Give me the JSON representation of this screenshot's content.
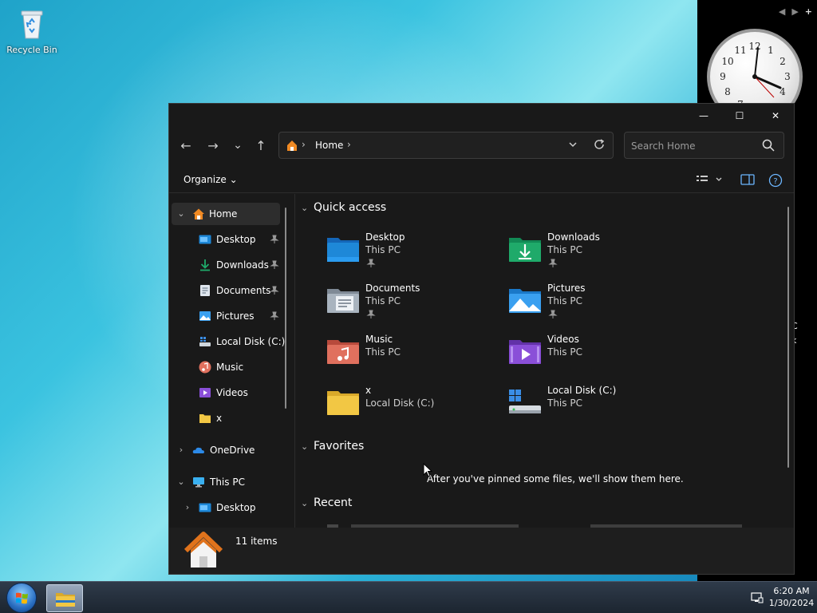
{
  "desktop": {
    "recycle_bin_label": "Recycle Bin",
    "side_text": [
      "C",
      "k"
    ]
  },
  "explorer": {
    "window_controls": {
      "minimize": "—",
      "maximize": "☐",
      "close": "✕"
    },
    "nav": {
      "back": "←",
      "forward": "→",
      "recent": "⌄",
      "up": "↑"
    },
    "address": {
      "crumb": "Home",
      "separator": "›"
    },
    "search": {
      "placeholder": "Search Home"
    },
    "command_bar": {
      "organize_label": "Organize",
      "organize_chevron": "⌄"
    },
    "nav_pane": {
      "items": [
        {
          "label": "Home",
          "chevron": "⌄",
          "icon": "home-icon",
          "active": true
        },
        {
          "label": "Desktop",
          "icon": "desktop-folder-icon",
          "pinned": true
        },
        {
          "label": "Downloads",
          "icon": "download-icon",
          "pinned": true
        },
        {
          "label": "Documents",
          "icon": "documents-icon",
          "pinned": true
        },
        {
          "label": "Pictures",
          "icon": "pictures-icon",
          "pinned": true
        },
        {
          "label": "Local Disk (C:)",
          "icon": "drive-icon"
        },
        {
          "label": "Music",
          "icon": "music-icon"
        },
        {
          "label": "Videos",
          "icon": "videos-icon"
        },
        {
          "label": "x",
          "icon": "folder-icon"
        },
        {
          "label": "OneDrive",
          "chevron": "›",
          "icon": "onedrive-icon"
        },
        {
          "label": "This PC",
          "chevron": "⌄",
          "icon": "this-pc-icon"
        },
        {
          "label": "Desktop",
          "chevron": "›",
          "icon": "desktop-folder-icon"
        }
      ]
    },
    "content": {
      "quick_access": {
        "title": "Quick access",
        "chevron": "⌄",
        "items": [
          {
            "name": "Desktop",
            "location": "This PC",
            "pinned": true,
            "icon": "desktop-folder-icon"
          },
          {
            "name": "Downloads",
            "location": "This PC",
            "pinned": true,
            "icon": "download-icon"
          },
          {
            "name": "Documents",
            "location": "This PC",
            "pinned": true,
            "icon": "documents-icon"
          },
          {
            "name": "Pictures",
            "location": "This PC",
            "pinned": true,
            "icon": "pictures-icon"
          },
          {
            "name": "Music",
            "location": "This PC",
            "icon": "music-icon"
          },
          {
            "name": "Videos",
            "location": "This PC",
            "icon": "videos-icon"
          },
          {
            "name": "x",
            "location": "Local Disk (C:)",
            "icon": "folder-icon"
          },
          {
            "name": "Local Disk (C:)",
            "location": "This PC",
            "icon": "drive-icon"
          }
        ]
      },
      "favorites": {
        "title": "Favorites",
        "chevron": "⌄",
        "empty_message": "After you've pinned some files, we'll show them here."
      },
      "recent": {
        "title": "Recent",
        "chevron": "⌄"
      }
    },
    "status_bar": {
      "item_count": "11 items"
    }
  },
  "taskbar": {
    "time": "6:20 AM",
    "date": "1/30/2024"
  },
  "colors": {
    "window_bg": "#191919",
    "folder_blue": "#1e88d8",
    "folder_yellow": "#f2c744",
    "download_green": "#1faa6a"
  }
}
